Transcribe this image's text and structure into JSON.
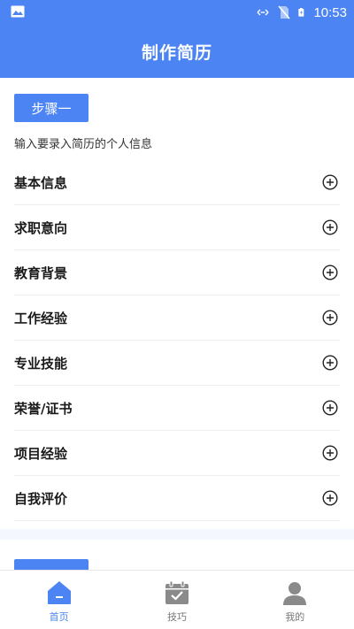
{
  "status_bar": {
    "time": "10:53"
  },
  "header": {
    "title": "制作简历"
  },
  "step1": {
    "button_label": "步骤一",
    "subtitle": "输入要录入简历的个人信息",
    "items": [
      {
        "label": "基本信息"
      },
      {
        "label": "求职意向"
      },
      {
        "label": "教育背景"
      },
      {
        "label": "工作经验"
      },
      {
        "label": "专业技能"
      },
      {
        "label": "荣誉/证书"
      },
      {
        "label": "项目经验"
      },
      {
        "label": "自我评价"
      }
    ]
  },
  "tabs": [
    {
      "label": "首页",
      "icon": "home-icon",
      "active": true
    },
    {
      "label": "技巧",
      "icon": "calendar-check-icon",
      "active": false
    },
    {
      "label": "我的",
      "icon": "user-icon",
      "active": false
    }
  ],
  "colors": {
    "primary": "#4c84f3",
    "inactive_icon": "#8a8a8a"
  }
}
